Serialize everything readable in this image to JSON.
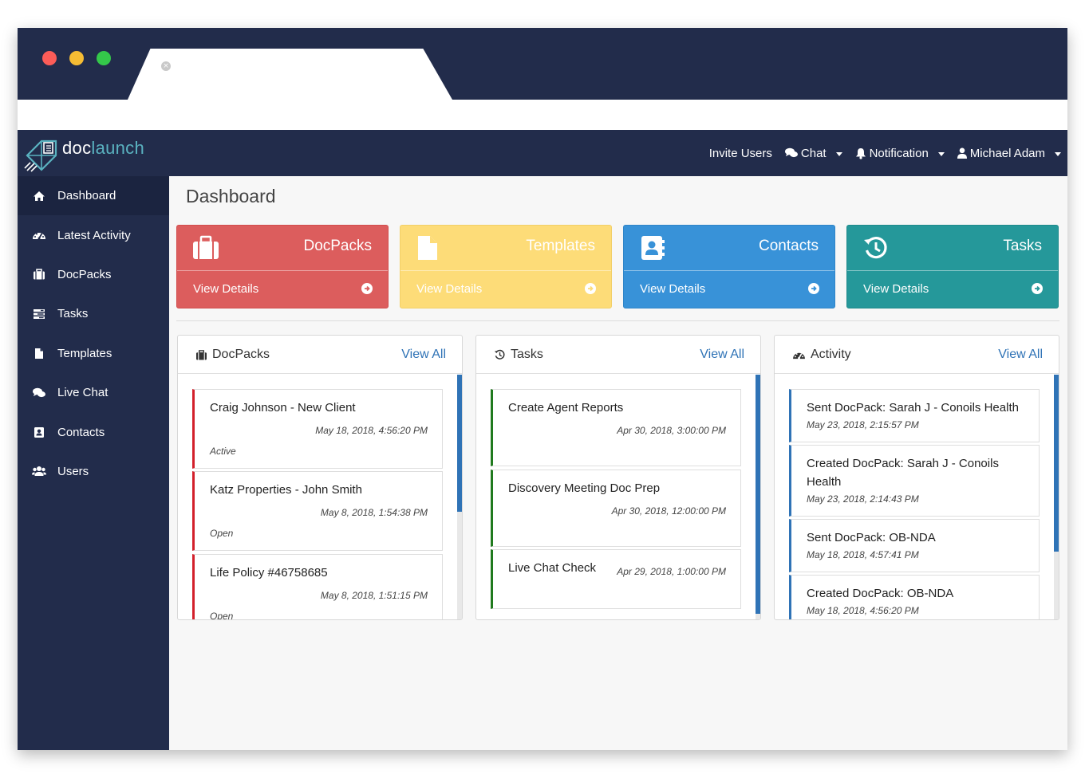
{
  "app": {
    "logo_main": "doc",
    "logo_accent": "launch"
  },
  "nav": {
    "invite_users": "Invite Users",
    "chat": "Chat",
    "notification": "Notification",
    "user": "Michael Adam"
  },
  "sidebar": {
    "items": [
      {
        "label": "Dashboard",
        "icon": "home-icon"
      },
      {
        "label": "Latest Activity",
        "icon": "dashboard-icon"
      },
      {
        "label": "DocPacks",
        "icon": "briefcase-icon"
      },
      {
        "label": "Tasks",
        "icon": "tasks-icon"
      },
      {
        "label": "Templates",
        "icon": "file-icon"
      },
      {
        "label": "Live Chat",
        "icon": "chat-icon"
      },
      {
        "label": "Contacts",
        "icon": "address-book-icon"
      },
      {
        "label": "Users",
        "icon": "users-icon"
      }
    ]
  },
  "page": {
    "title": "Dashboard"
  },
  "tiles": [
    {
      "title": "DocPacks",
      "link": "View Details",
      "color": "#dc5d5d"
    },
    {
      "title": "Templates",
      "link": "View Details",
      "color": "#fddc78"
    },
    {
      "title": "Contacts",
      "link": "View Details",
      "color": "#3892d8"
    },
    {
      "title": "Tasks",
      "link": "View Details",
      "color": "#25989a"
    }
  ],
  "panels": {
    "docpacks": {
      "title": "DocPacks",
      "view_all": "View All",
      "items": [
        {
          "title": "Craig Johnson - New Client",
          "date": "May 18, 2018, 4:56:20 PM",
          "status": "Active"
        },
        {
          "title": "Katz Properties - John Smith",
          "date": "May 8, 2018, 1:54:38 PM",
          "status": "Open"
        },
        {
          "title": "Life Policy #46758685",
          "date": "May 8, 2018, 1:51:15 PM",
          "status": "Open"
        }
      ]
    },
    "tasks": {
      "title": "Tasks",
      "view_all": "View All",
      "items": [
        {
          "title": "Create Agent Reports",
          "date": "Apr 30, 2018, 3:00:00 PM"
        },
        {
          "title": "Discovery Meeting Doc Prep",
          "date": "Apr 30, 2018, 12:00:00 PM"
        },
        {
          "title": "Live Chat Check",
          "date": "Apr 29, 2018, 1:00:00 PM"
        }
      ]
    },
    "activity": {
      "title": "Activity",
      "view_all": "View All",
      "items": [
        {
          "title": "Sent DocPack: Sarah J - Conoils Health",
          "date": "May 23, 2018, 2:15:57 PM"
        },
        {
          "title": "Created DocPack: Sarah J - Conoils Health",
          "date": "May 23, 2018, 2:14:43 PM"
        },
        {
          "title": "Sent DocPack: OB-NDA",
          "date": "May 18, 2018, 4:57:41 PM"
        },
        {
          "title": "Created DocPack: OB-NDA",
          "date": "May 18, 2018, 4:56:20 PM"
        }
      ]
    }
  },
  "colors": {
    "navy": "#222c4b",
    "link": "#2f73b6",
    "docpack_accent": "#d3202b",
    "task_accent": "#207a1e",
    "activity_accent": "#2f73b6"
  }
}
